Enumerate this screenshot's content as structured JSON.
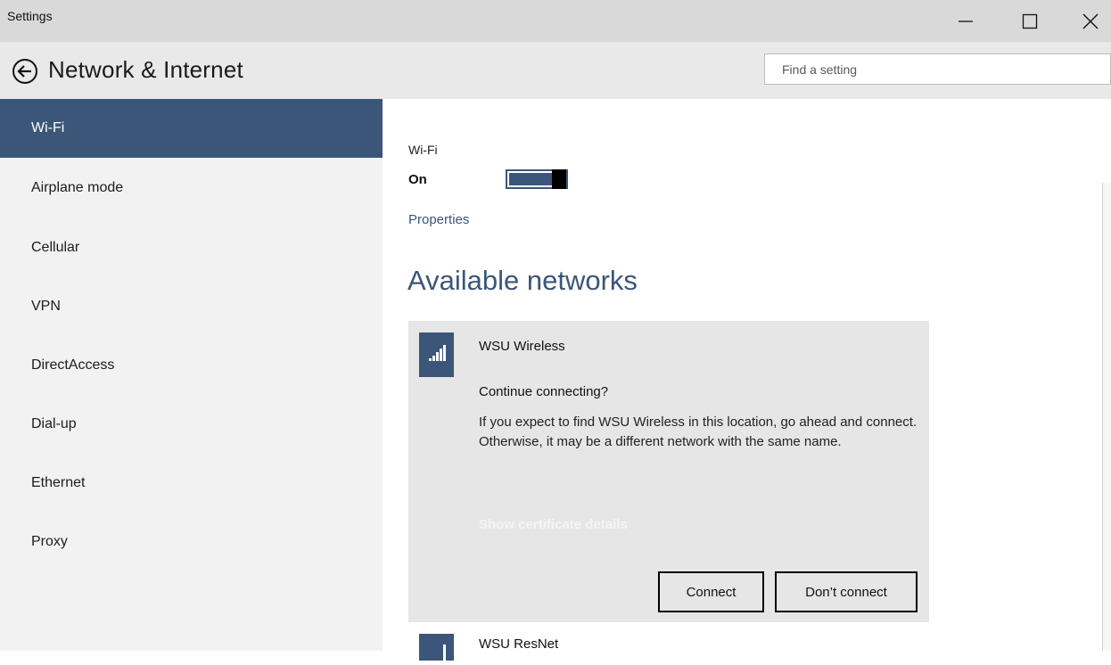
{
  "window": {
    "title": "Settings"
  },
  "header": {
    "title": "Network & Internet",
    "search_placeholder": "Find a setting"
  },
  "sidebar": {
    "items": [
      {
        "label": "Wi-Fi",
        "active": true
      },
      {
        "label": "Airplane mode"
      },
      {
        "label": "Cellular"
      },
      {
        "label": "VPN"
      },
      {
        "label": "DirectAccess"
      },
      {
        "label": "Dial-up"
      },
      {
        "label": "Ethernet"
      },
      {
        "label": "Proxy"
      }
    ]
  },
  "wifi": {
    "label": "Wi-Fi",
    "state": "On",
    "toggle_on": true,
    "properties_link": "Properties"
  },
  "networks": {
    "section_title": "Available networks",
    "items": [
      {
        "name": "WSU Wireless",
        "question": "Continue connecting?",
        "description": "If you expect to find WSU Wireless in this location, go ahead and connect. Otherwise, it may be a different network with the same name.",
        "cert_link": "Show certificate details",
        "connect_label": "Connect",
        "dont_connect_label": "Don’t connect"
      },
      {
        "name": "WSU ResNet"
      }
    ]
  },
  "colors": {
    "accent": "#3b5679",
    "sidebar_bg": "#f2f2f2",
    "titlebar_bg": "#d9d9d9",
    "card_bg": "#e6e6e6"
  },
  "icons": {
    "back": "back-arrow-icon",
    "signal": "wifi-signal-icon",
    "minimize": "minimize-icon",
    "maximize": "maximize-icon",
    "close": "close-icon"
  }
}
